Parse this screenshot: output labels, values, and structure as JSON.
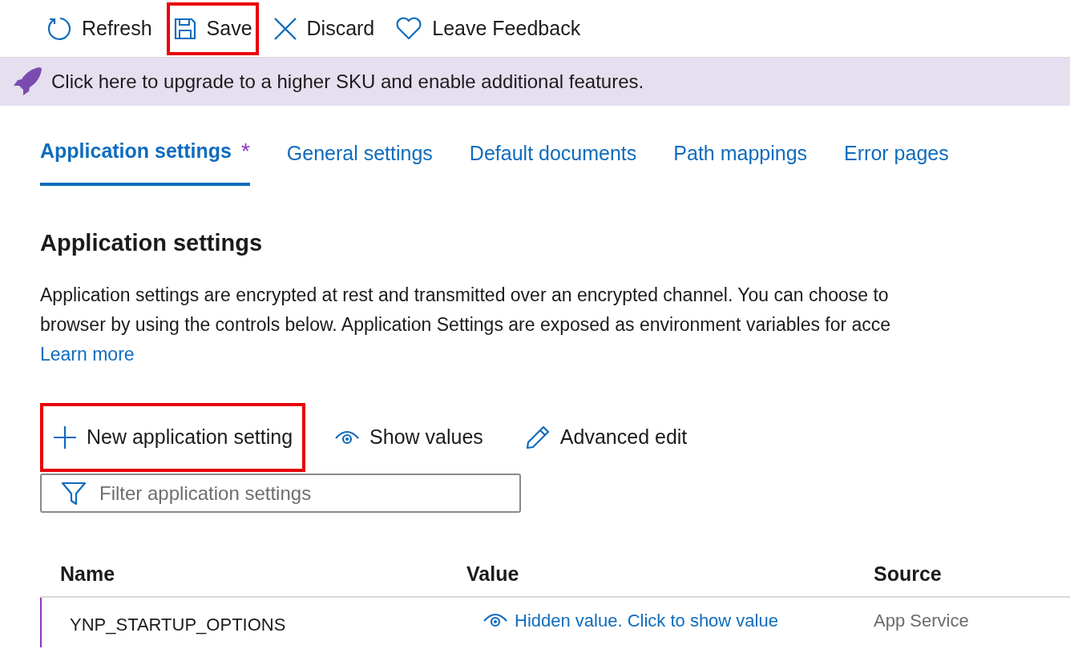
{
  "toolbar": [
    {
      "kind": "refresh",
      "label": "Refresh",
      "highlighted": false
    },
    {
      "kind": "save",
      "label": "Save",
      "highlighted": true
    },
    {
      "kind": "discard",
      "label": "Discard",
      "highlighted": false
    },
    {
      "kind": "feedback",
      "label": "Leave Feedback",
      "highlighted": false
    }
  ],
  "banner": {
    "text": "Click here to upgrade to a higher SKU and enable additional features."
  },
  "tabs": [
    {
      "label": "Application settings",
      "modified_mark": "*",
      "selected": true
    },
    {
      "label": "General settings",
      "selected": false
    },
    {
      "label": "Default documents",
      "selected": false
    },
    {
      "label": "Path mappings",
      "selected": false
    },
    {
      "label": "Error pages",
      "selected": false
    }
  ],
  "section": {
    "title": "Application settings",
    "description_lines": [
      "Application settings are encrypted at rest and transmitted over an encrypted channel. You can choose to",
      "browser by using the controls below. Application Settings are exposed as environment variables for acce"
    ],
    "learn_more": "Learn more"
  },
  "actions": [
    {
      "kind": "add",
      "label": "New application setting",
      "highlighted": true
    },
    {
      "kind": "show",
      "label": "Show values",
      "highlighted": false
    },
    {
      "kind": "edit",
      "label": "Advanced edit",
      "highlighted": false
    }
  ],
  "filter": {
    "placeholder": "Filter application settings"
  },
  "table": {
    "columns": [
      "Name",
      "Value",
      "Source"
    ],
    "rows": [
      {
        "name": "YNP_STARTUP_OPTIONS",
        "value": "Hidden value. Click to show value",
        "source": "App Service"
      }
    ]
  }
}
